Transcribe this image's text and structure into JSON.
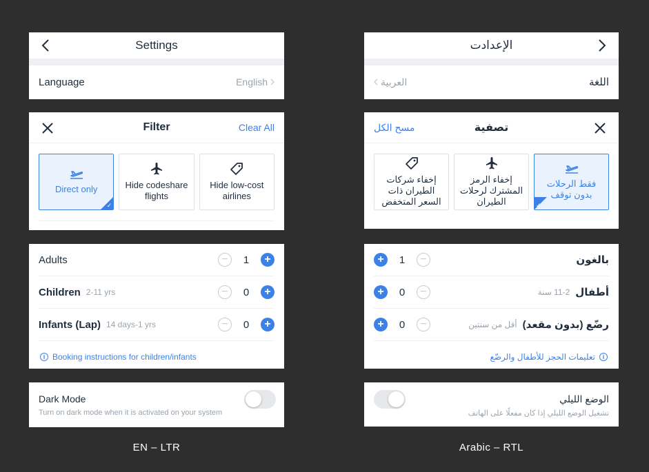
{
  "en": {
    "settings": {
      "title": "Settings",
      "language_label": "Language",
      "language_value": "English"
    },
    "filter": {
      "title": "Filter",
      "clear": "Clear All",
      "options": [
        {
          "label": "Direct only",
          "icon": "direct-flight-icon",
          "selected": true
        },
        {
          "label": "Hide codeshare flights",
          "icon": "plane-icon",
          "selected": false
        },
        {
          "label": "Hide low-cost airlines",
          "icon": "tag-icon",
          "selected": false
        }
      ]
    },
    "passengers": {
      "rows": [
        {
          "label": "Adults",
          "sub": "",
          "count": "1"
        },
        {
          "label": "Children",
          "sub": "2-11 yrs",
          "count": "0"
        },
        {
          "label": "Infants (Lap)",
          "sub": "14 days-1 yrs",
          "count": "0"
        }
      ],
      "info": "Booking instructions for children/infants"
    },
    "dark_mode": {
      "label": "Dark Mode",
      "desc": "Turn on dark mode when it is activated on your system",
      "on": false
    },
    "caption": "EN – LTR"
  },
  "ar": {
    "settings": {
      "title": "الإعدادت",
      "language_label": "اللغة",
      "language_value": "العربية"
    },
    "filter": {
      "title": "تصفية",
      "clear": "مسح الكل",
      "options": [
        {
          "label": "فقط الرحلات بدون توقف",
          "icon": "direct-flight-icon",
          "selected": true
        },
        {
          "label": "إخفاء الرمز المشترك لرحلات الطيران",
          "icon": "plane-icon",
          "selected": false
        },
        {
          "label": "إخفاء شركات الطيران ذات السعر المتخفض",
          "icon": "tag-icon",
          "selected": false
        }
      ]
    },
    "passengers": {
      "rows": [
        {
          "label": "بالغون",
          "sub": "",
          "count": "1"
        },
        {
          "label": "أطفال",
          "sub": "11-2 سنة",
          "count": "0"
        },
        {
          "label": "رضّع (بدون مقعد)",
          "sub": "أقل من سنتين",
          "count": "0"
        }
      ],
      "info": "تعليمات الحجز للأطفال والرضّع"
    },
    "dark_mode": {
      "label": "الوضع الليلي",
      "desc": "تشغيل الوضع الليلي إذا كان مفعلًا على الهاتف",
      "on": false
    },
    "caption": "Arabic – RTL"
  },
  "colors": {
    "accent": "#3c82e6",
    "background": "#2e2e2e",
    "selected_fill": "#eaf2fd"
  }
}
